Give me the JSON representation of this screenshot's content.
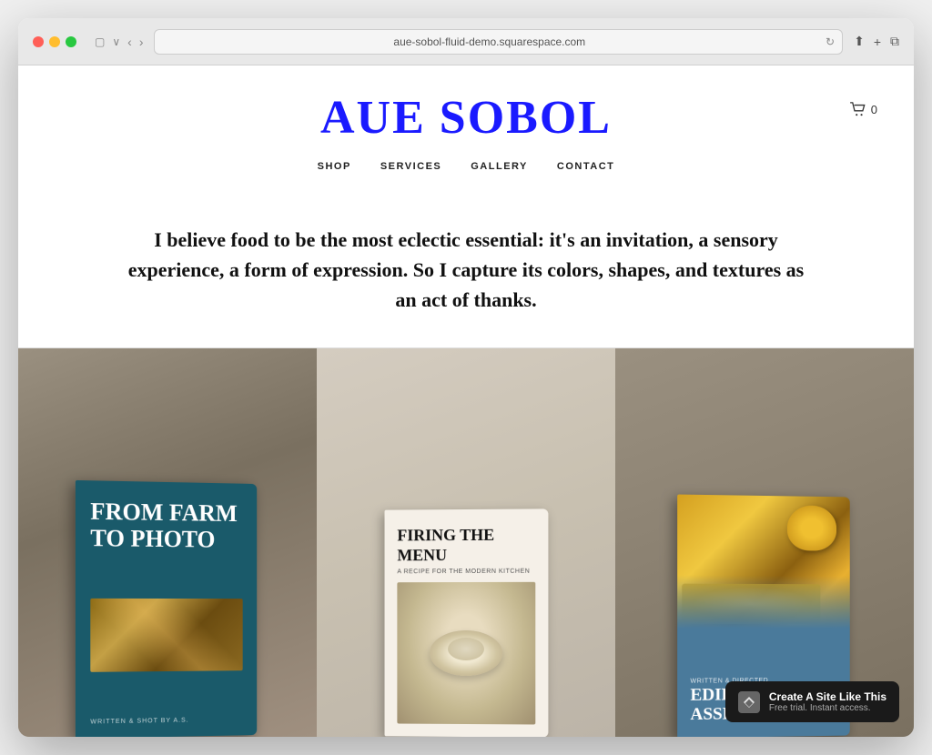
{
  "browser": {
    "url": "aue-sobol-fluid-demo.squarespace.com",
    "title": "AUE SOBOL"
  },
  "header": {
    "site_title": "AUE SOBOL",
    "cart_count": "0",
    "nav": {
      "items": [
        {
          "label": "SHOP",
          "href": "#"
        },
        {
          "label": "SERVICES",
          "href": "#"
        },
        {
          "label": "GALLERY",
          "href": "#"
        },
        {
          "label": "CONTACT",
          "href": "#"
        }
      ]
    }
  },
  "hero": {
    "quote": "I believe food to be the most eclectic essential: it's an invitation, a sensory experience, a form of expression. So I capture its colors, shapes, and textures as an act of thanks."
  },
  "books": [
    {
      "id": "book-1",
      "title": "FROM FARM TO PHOTO",
      "author": "WRITTEN & SHOT BY A.S.",
      "bg_color": "#1a5a6a"
    },
    {
      "id": "book-2",
      "title": "FIRING THE MENU",
      "subtitle": "A RECIPE FOR THE MODERN KITCHEN",
      "bg_color": "#f5f0e8"
    },
    {
      "id": "book-3",
      "title": "EDIBLES ASSEMBLED",
      "subtitle": "WRITTEN & DIRECTED",
      "bg_color": "#4a7a9b"
    }
  ],
  "squarespace_banner": {
    "main_text": "Create A Site Like This",
    "sub_text": "Free trial. Instant access."
  }
}
